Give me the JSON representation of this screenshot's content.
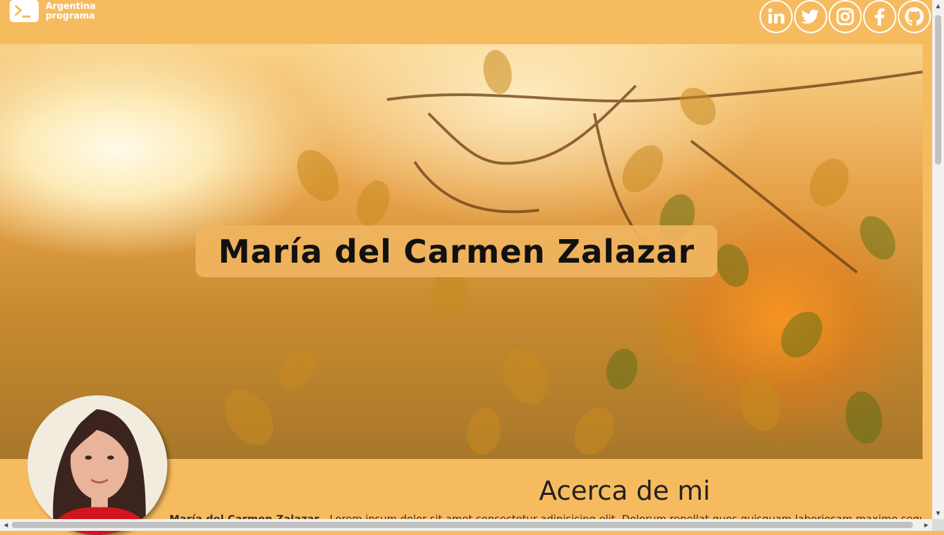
{
  "header": {
    "logo_icon": "terminal-prompt-icon",
    "logo_line1": "Argentina",
    "logo_line2": "programa",
    "social": [
      {
        "name": "linkedin-icon"
      },
      {
        "name": "twitter-icon"
      },
      {
        "name": "instagram-icon"
      },
      {
        "name": "facebook-icon"
      },
      {
        "name": "github-icon"
      }
    ]
  },
  "hero": {
    "title": "María del Carmen Zalazar"
  },
  "about": {
    "title": "Acerca de mi",
    "name": "María del Carmen Zalazar",
    "text": "Lorem ipsum dolor sit amet consectetur adipisicing elit. Dolorum repellat quos quisquam laboriosam maxime sequi illo"
  },
  "colors": {
    "accent": "#f7bb5f",
    "text": "#111111"
  }
}
